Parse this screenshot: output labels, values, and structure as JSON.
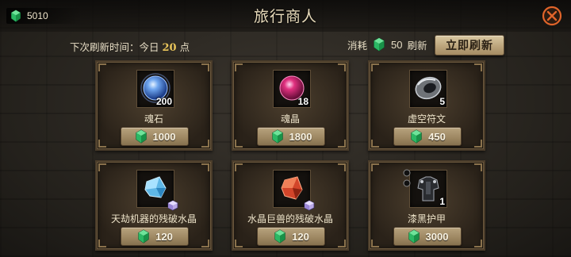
{
  "header": {
    "title": "旅行商人",
    "currency_amount": "5010"
  },
  "refresh": {
    "label": "下次刷新时间：今日",
    "hour": "20",
    "unit": "点",
    "cost_label": "消耗",
    "cost_amount": "50",
    "cost_suffix": "刷新",
    "button_label": "立即刷新"
  },
  "items": [
    {
      "name": "魂石",
      "quantity": "200",
      "price": "1000",
      "icon": "blue-soul-orb"
    },
    {
      "name": "魂晶",
      "quantity": "18",
      "price": "1800",
      "icon": "pink-soul-crystal"
    },
    {
      "name": "虚空符文",
      "quantity": "5",
      "price": "450",
      "icon": "void-rune"
    },
    {
      "name": "天劫机器的残破水晶",
      "quantity": "",
      "price": "120",
      "icon": "blue-broken-crystal"
    },
    {
      "name": "水晶巨兽的残破水晶",
      "quantity": "",
      "price": "120",
      "icon": "red-broken-crystal"
    },
    {
      "name": "漆黑护甲",
      "quantity": "1",
      "price": "3000",
      "icon": "black-armor"
    }
  ],
  "colors": {
    "gem": "#2fc06a",
    "highlight": "#e8c45a",
    "close": "#e0642a"
  }
}
